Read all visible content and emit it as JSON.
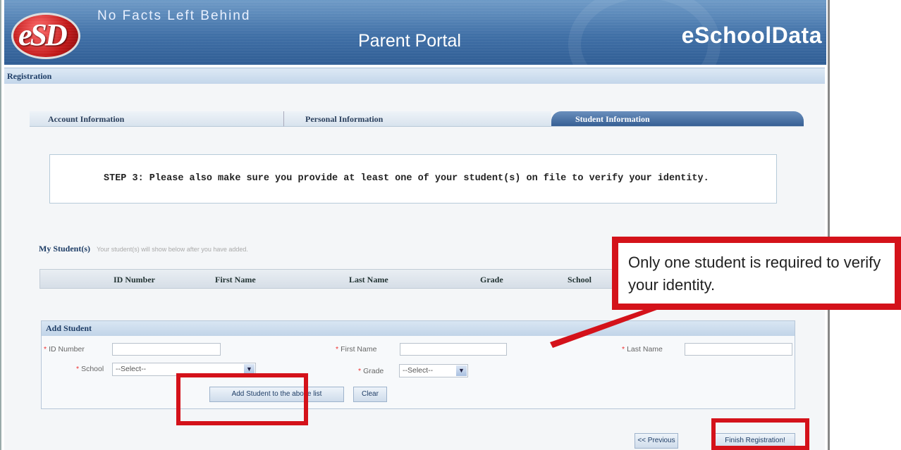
{
  "header": {
    "logo_text": "eSD",
    "tagline": "No Facts Left Behind",
    "portal_title": "Parent Portal",
    "brand": "eSchoolData"
  },
  "page": {
    "registration_label": "Registration"
  },
  "tabs": [
    {
      "label": "Account Information",
      "active": false
    },
    {
      "label": "Personal Information",
      "active": false
    },
    {
      "label": "Student Information",
      "active": true
    }
  ],
  "step": {
    "text": "STEP 3: Please also make sure you provide at least one of your student(s) on file to verify your identity."
  },
  "my_students": {
    "title": "My Student(s)",
    "hint": "Your student(s) will show below after you have added.",
    "columns": [
      "ID Number",
      "First Name",
      "Last Name",
      "Grade",
      "School"
    ]
  },
  "add_student": {
    "title": "Add Student",
    "required_marker": "*",
    "id_label": "ID Number",
    "first_name_label": "First Name",
    "last_name_label": "Last Name",
    "school_label": "School",
    "school_selected": "--Select--",
    "grade_label": "Grade",
    "grade_selected": "--Select--",
    "add_button": "Add Student to the above list",
    "clear_button": "Clear"
  },
  "nav": {
    "previous_button": "<< Previous",
    "finish_button": "Finish Registration!"
  },
  "callout": {
    "text": "Only one student is required to verify your identity."
  },
  "colors": {
    "header_blue": "#3f6fa6",
    "highlight_red": "#d4121a",
    "active_tab": "#365f94"
  }
}
